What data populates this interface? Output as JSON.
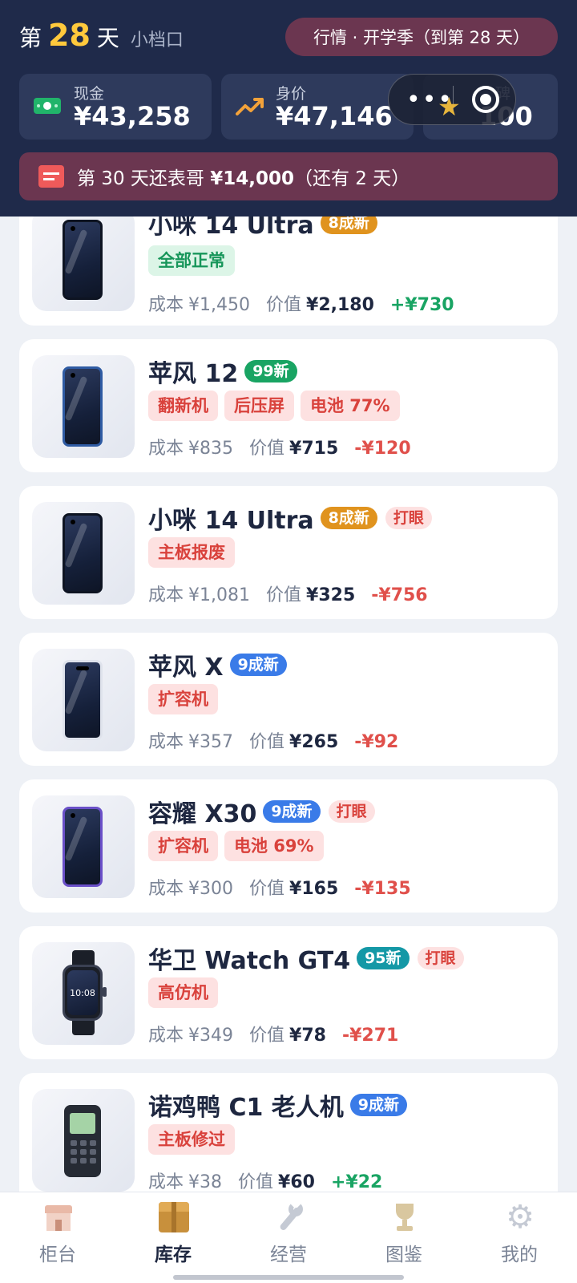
{
  "header": {
    "day_prefix": "第",
    "day_number": "28",
    "day_suffix": "天",
    "shop_name": "小档口",
    "market": "行情 · 开学季（到第 28 天）",
    "cash_label": "现金",
    "cash_value": "¥43,258",
    "worth_label": "身价",
    "worth_value": "¥47,146",
    "reputation_label": "碑",
    "reputation_value": "100",
    "debt_prefix": "第 30 天还表哥 ",
    "debt_amount": "¥14,000",
    "debt_suffix": "（还有 2 天）"
  },
  "price_labels": {
    "cost": "成本",
    "value": "价值"
  },
  "inventory": [
    {
      "name": "小咪 14 Ultra",
      "condition": "8成新",
      "eye_catching": "",
      "tags": [
        "全部正常"
      ],
      "cost": "¥1,450",
      "value": "¥2,180",
      "delta": "+¥730"
    },
    {
      "name": "苹风 12",
      "condition": "99新",
      "eye_catching": "",
      "tags": [
        "翻新机",
        "后压屏",
        "电池 77%"
      ],
      "cost": "¥835",
      "value": "¥715",
      "delta": "-¥120"
    },
    {
      "name": "小咪 14 Ultra",
      "condition": "8成新",
      "eye_catching": "打眼",
      "tags": [
        "主板报废"
      ],
      "cost": "¥1,081",
      "value": "¥325",
      "delta": "-¥756"
    },
    {
      "name": "苹风 X",
      "condition": "9成新",
      "eye_catching": "",
      "tags": [
        "扩容机"
      ],
      "cost": "¥357",
      "value": "¥265",
      "delta": "-¥92"
    },
    {
      "name": "容耀 X30",
      "condition": "9成新",
      "eye_catching": "打眼",
      "tags": [
        "扩容机",
        "电池 69%"
      ],
      "cost": "¥300",
      "value": "¥165",
      "delta": "-¥135"
    },
    {
      "name": "华卫 Watch GT4",
      "condition": "95新",
      "eye_catching": "打眼",
      "tags": [
        "高仿机"
      ],
      "cost": "¥349",
      "value": "¥78",
      "delta": "-¥271",
      "watch_time": "10:08"
    },
    {
      "name": "诺鸡鸭 C1 老人机",
      "condition": "9成新",
      "eye_catching": "",
      "tags": [
        "主板修过"
      ],
      "cost": "¥38",
      "value": "¥60",
      "delta": "+¥22"
    }
  ],
  "nav": [
    {
      "label": "柜台",
      "icon": "counter-icon"
    },
    {
      "label": "库存",
      "icon": "box-icon",
      "active": true
    },
    {
      "label": "经营",
      "icon": "wrench-icon"
    },
    {
      "label": "图鉴",
      "icon": "trophy-icon"
    },
    {
      "label": "我的",
      "icon": "gear-icon"
    }
  ],
  "colors": {
    "header_bg": "#1f2a4a",
    "accent_gold": "#ffc93c",
    "profit_green": "#19a463",
    "loss_red": "#e0504b",
    "tag_red_bg": "#fde1e1"
  }
}
